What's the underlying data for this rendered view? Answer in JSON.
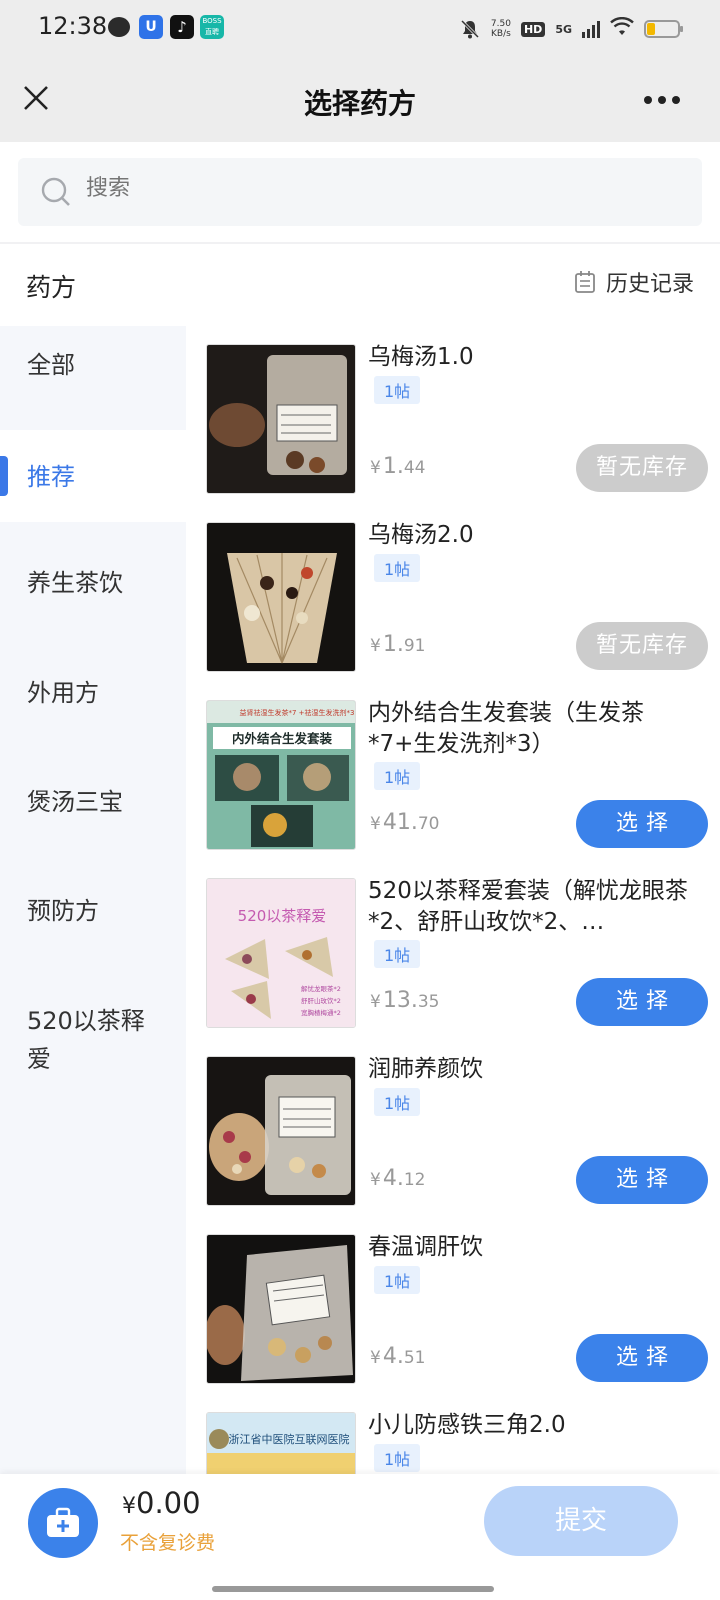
{
  "status_bar": {
    "time": "12:38",
    "net_speed_value": "7.50",
    "net_speed_unit": "KB/s",
    "hd_label": "HD",
    "network_label": "5G",
    "boss_label_top": "BOSS",
    "boss_label_bottom": "直聘",
    "battery_level": 0.25,
    "battery_color": "#f3b800"
  },
  "nav": {
    "title": "选择药方"
  },
  "search": {
    "placeholder": "搜索"
  },
  "section": {
    "title": "药方",
    "history_label": "历史记录"
  },
  "sidebar": {
    "items": [
      {
        "label": "全部"
      },
      {
        "label": "推荐"
      },
      {
        "label": "养生茶饮"
      },
      {
        "label": "外用方"
      },
      {
        "label": "煲汤三宝"
      },
      {
        "label": "预防方"
      },
      {
        "label": "520以茶释爱"
      }
    ],
    "active_index": 1
  },
  "products": [
    {
      "name": "乌梅汤1.0",
      "tag": "1帖",
      "price_yen": "¥",
      "price_int": "1.",
      "price_cents": "44",
      "button": "暂无库存"
    },
    {
      "name": "乌梅汤2.0",
      "tag": "1帖",
      "price_yen": "¥",
      "price_int": "1.",
      "price_cents": "91",
      "button": "暂无库存"
    },
    {
      "name": "内外结合生发套装（生发茶*7+生发洗剂*3）",
      "tag": "1帖",
      "price_yen": "¥",
      "price_int": "41.",
      "price_cents": "70",
      "button": "选择",
      "thumb_line1": "内外结合生发套装",
      "thumb_line0": "益肾祛湿生发茶*7 +祛湿生发洗剂*3"
    },
    {
      "name": "520以茶释爱套装（解忧龙眼茶*2、舒肝山玫饮*2、…",
      "tag": "1帖",
      "price_yen": "¥",
      "price_int": "13.",
      "price_cents": "35",
      "button": "选择",
      "thumb_line1": "520以茶释爱",
      "thumb_line2": "解忧龙眼茶*2",
      "thumb_line3": "舒肝山玫饮*2",
      "thumb_line4": "宽胸楂梅通*2"
    },
    {
      "name": "润肺养颜饮",
      "tag": "1帖",
      "price_yen": "¥",
      "price_int": "4.",
      "price_cents": "12",
      "button": "选择"
    },
    {
      "name": "春温调肝饮",
      "tag": "1帖",
      "price_yen": "¥",
      "price_int": "4.",
      "price_cents": "51",
      "button": "选择"
    },
    {
      "name": "小儿防感铁三角2.0",
      "tag": "1帖",
      "thumb_line1": "浙江省中医院互联网医院"
    }
  ],
  "bottom": {
    "total_yen": "¥",
    "total_amount": "0.00",
    "fee_note": "不含复诊费",
    "submit_label": "提交"
  },
  "colors": {
    "accent": "#3b82ea",
    "disabled_button": "#cccccc",
    "submit_disabled": "#b9d3f9",
    "fee_note": "#e9a13a"
  }
}
